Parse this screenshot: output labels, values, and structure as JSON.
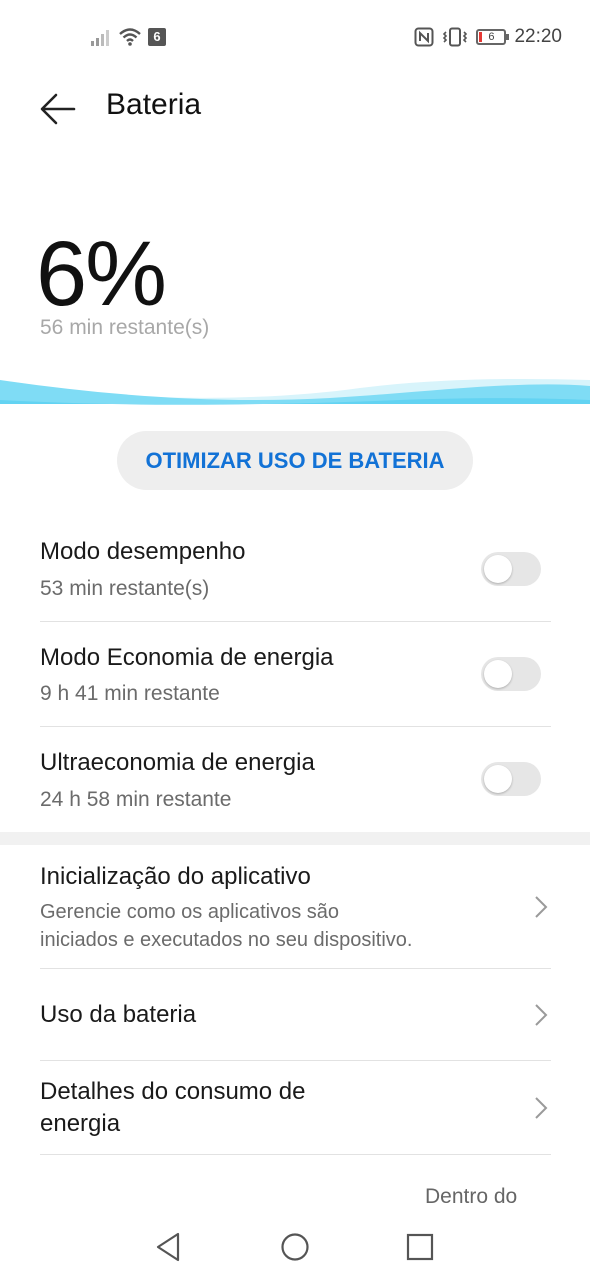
{
  "status_bar": {
    "sim_number": "6",
    "battery_level": "6",
    "time": "22:20"
  },
  "header": {
    "title": "Bateria"
  },
  "battery": {
    "percentage": "6%",
    "remaining": "56 min restante(s)"
  },
  "optimize_button": {
    "label": "OTIMIZAR USO DE BATERIA"
  },
  "modes": [
    {
      "title": "Modo desempenho",
      "subtitle": "53 min restante(s)",
      "enabled": false
    },
    {
      "title": "Modo Economia de energia",
      "subtitle": "9 h 41 min restante",
      "enabled": false
    },
    {
      "title": "Ultraeconomia de energia",
      "subtitle": "24 h 58 min restante",
      "enabled": false
    }
  ],
  "settings": [
    {
      "title": "Inicialização do aplicativo",
      "subtitle_line1": "Gerencie como os aplicativos são",
      "subtitle_line2": "iniciados e executados no seu dispositivo."
    },
    {
      "title": "Uso da bateria"
    },
    {
      "title_line1": "Detalhes do consumo de",
      "title_line2": "energia"
    }
  ],
  "bottom_partial_text": "Dentro do",
  "colors": {
    "accent": "#1272d6",
    "wave": "#7fdcf5",
    "toggle_off": "#e6e6e6"
  }
}
